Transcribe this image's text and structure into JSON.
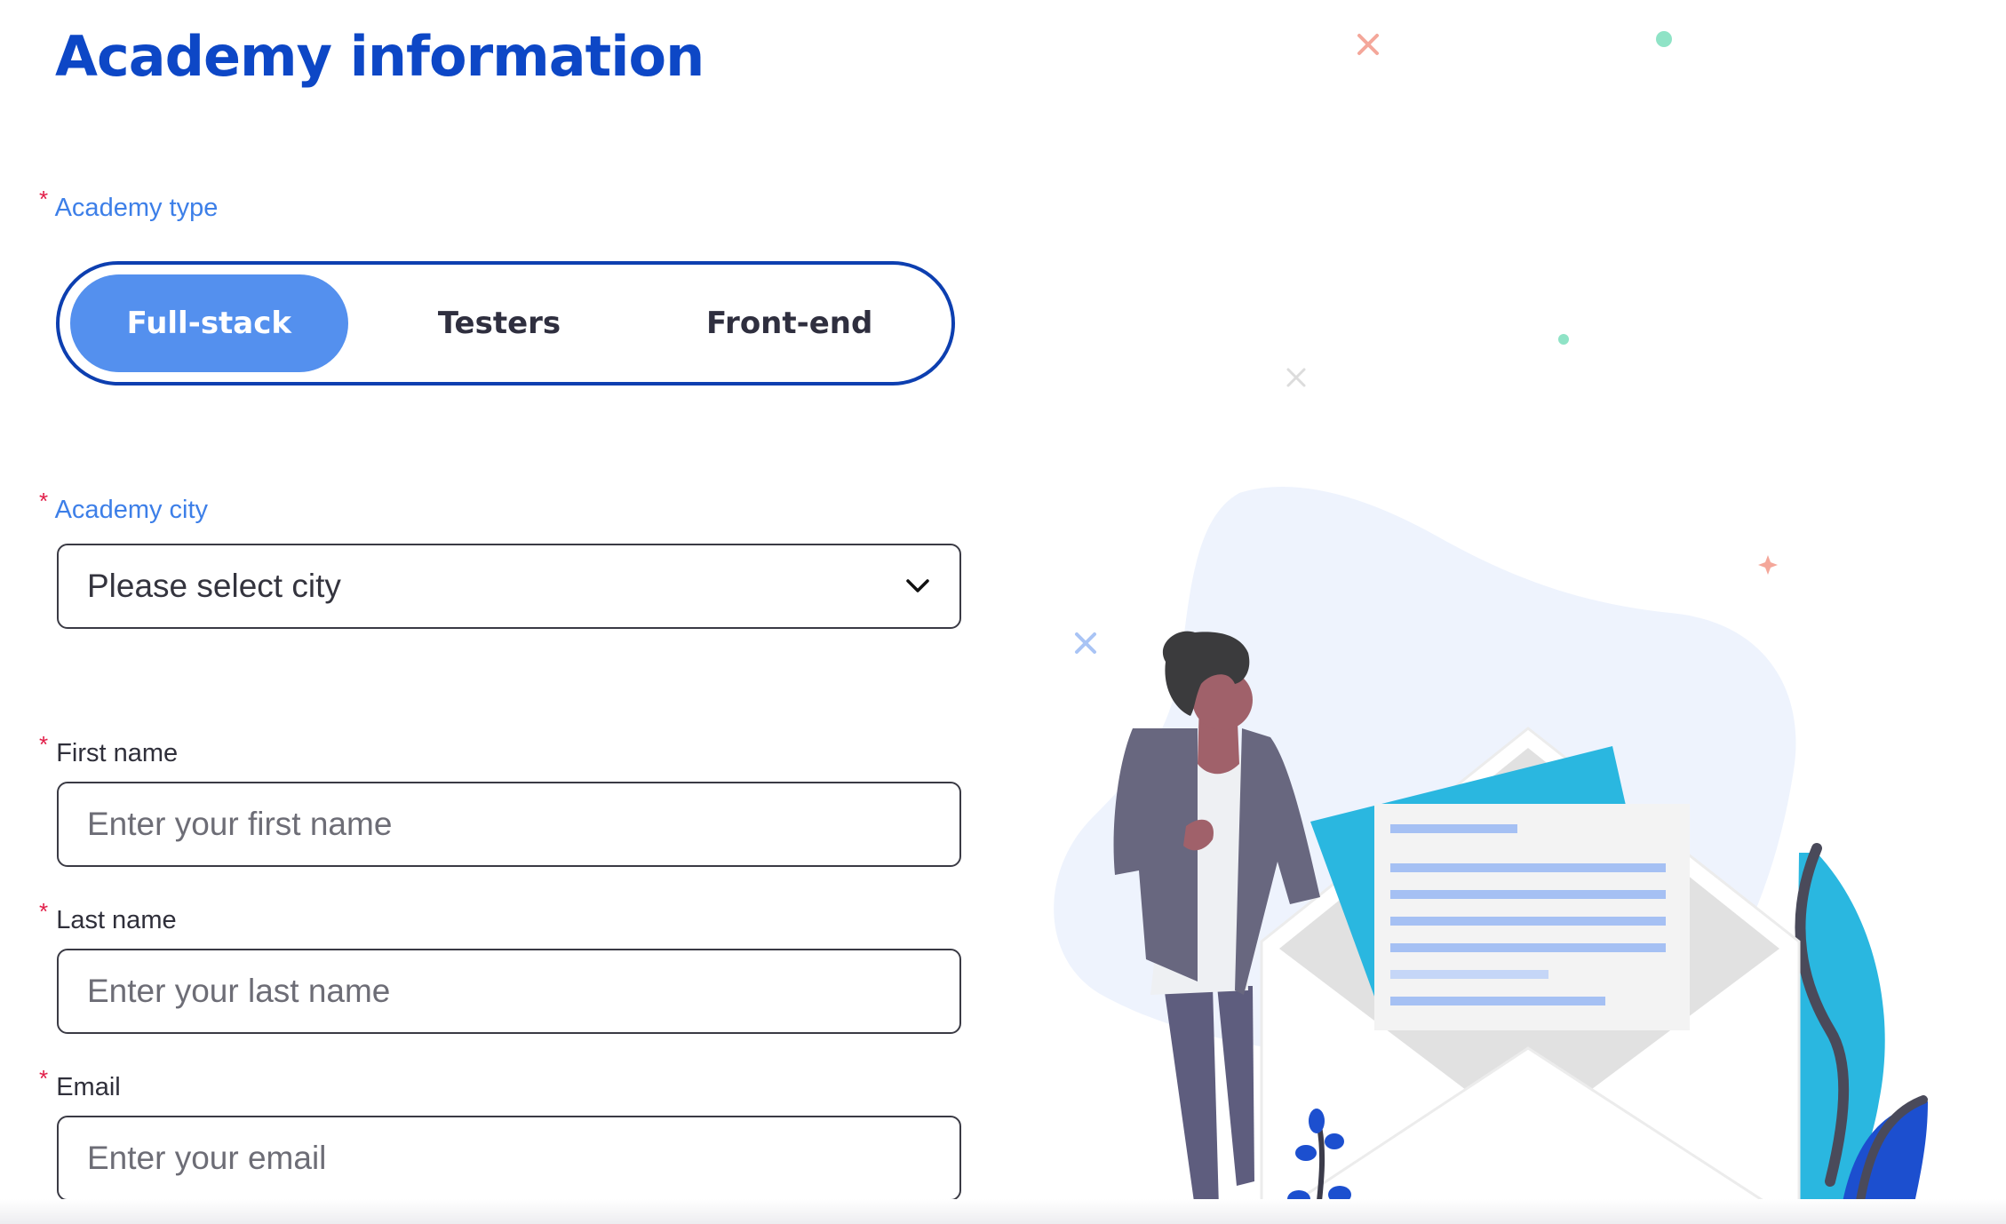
{
  "page": {
    "title": "Academy information"
  },
  "academy_type": {
    "required_mark": "*",
    "label": "Academy type",
    "options": [
      {
        "label": "Full-stack",
        "selected": true
      },
      {
        "label": "Testers",
        "selected": false
      },
      {
        "label": "Front-end",
        "selected": false
      }
    ]
  },
  "academy_city": {
    "required_mark": "*",
    "label": "Academy city",
    "selected_value": "Please select city",
    "icon": "chevron-down-icon"
  },
  "first_name": {
    "required_mark": "*",
    "label": "First name",
    "value": "",
    "placeholder": "Enter your first name"
  },
  "last_name": {
    "required_mark": "*",
    "label": "Last name",
    "value": "",
    "placeholder": "Enter your last name"
  },
  "email": {
    "required_mark": "*",
    "label": "Email",
    "value": "",
    "placeholder": "Enter your email"
  },
  "colors": {
    "title": "#0d47c6",
    "segment_border": "#0d3fb0",
    "segment_active": "#5490ee",
    "label_accent": "#3d7fe8",
    "required": "#e11d48"
  },
  "illustration": {
    "icon": "person-with-envelope-illustration"
  }
}
